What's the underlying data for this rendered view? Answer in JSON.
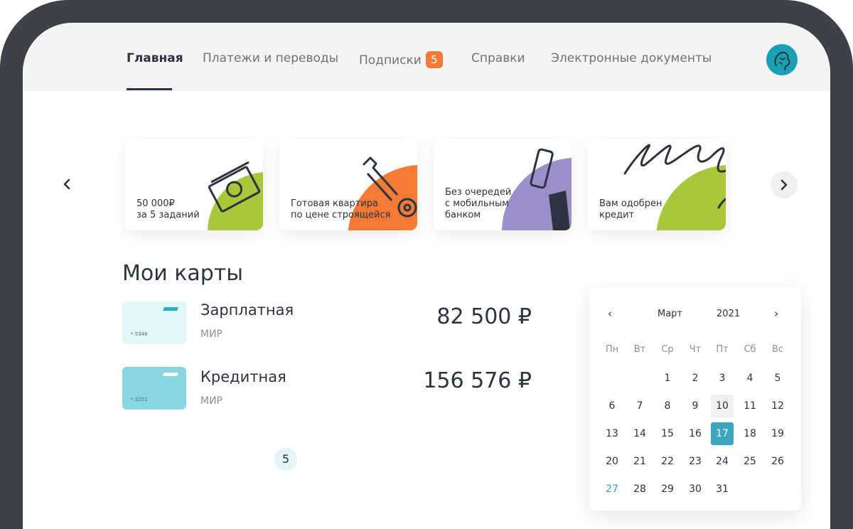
{
  "nav": {
    "items": [
      {
        "label": "Главная",
        "active": true
      },
      {
        "label": "Платежи и переводы",
        "active": false
      },
      {
        "label": "Подписки",
        "active": false,
        "badge": "5"
      },
      {
        "label": "Справки",
        "active": false
      },
      {
        "label": "Электронные документы",
        "active": false
      }
    ],
    "accent": "#f47a35"
  },
  "banners": [
    {
      "line1": "50 000₽",
      "line2": "за 5 заданий",
      "color": "#a8c83c",
      "icon": "banknote-icon"
    },
    {
      "line1": "Готовая квартира",
      "line2": "по цене строящейся",
      "color": "#f47a35",
      "icon": "key-icon"
    },
    {
      "line1": "Без очередей",
      "line2": "с мобильным",
      "line3": "банком",
      "color": "#9b8ec9",
      "icon": "phone-hand-icon"
    },
    {
      "line1": "Вам одобрен",
      "line2": "кредит",
      "color": "#a8c83c",
      "icon": "signature-icon"
    }
  ],
  "cards_section": {
    "title": "Мои карты",
    "cards": [
      {
        "name": "Зарплатная",
        "system": "МИР",
        "number": "* 5346",
        "balance": "82 500 ₽",
        "color": "#e2f5f7",
        "stripe": "#1fb1c4"
      },
      {
        "name": "Кредитная",
        "system": "МИР",
        "number": "* 3251",
        "balance": "156 576 ₽",
        "color": "#86d7e2",
        "stripe": "#ffffff"
      }
    ],
    "pager": "5"
  },
  "calendar": {
    "month": "Март",
    "year": "2021",
    "weekdays": [
      "Пн",
      "Вт",
      "Ср",
      "Чт",
      "Пт",
      "Сб",
      "Вс"
    ],
    "days": [
      "1",
      "2",
      "3",
      "4",
      "5",
      "6",
      "7",
      "8",
      "9",
      "10",
      "11",
      "12",
      "13",
      "14",
      "15",
      "16",
      "17",
      "18",
      "19",
      "20",
      "21",
      "22",
      "23",
      "24",
      "25",
      "26",
      "27",
      "28",
      "29",
      "30",
      "31"
    ],
    "today": "10",
    "selected": "17",
    "highlighted": "27",
    "selected_color": "#3aa5bb"
  }
}
